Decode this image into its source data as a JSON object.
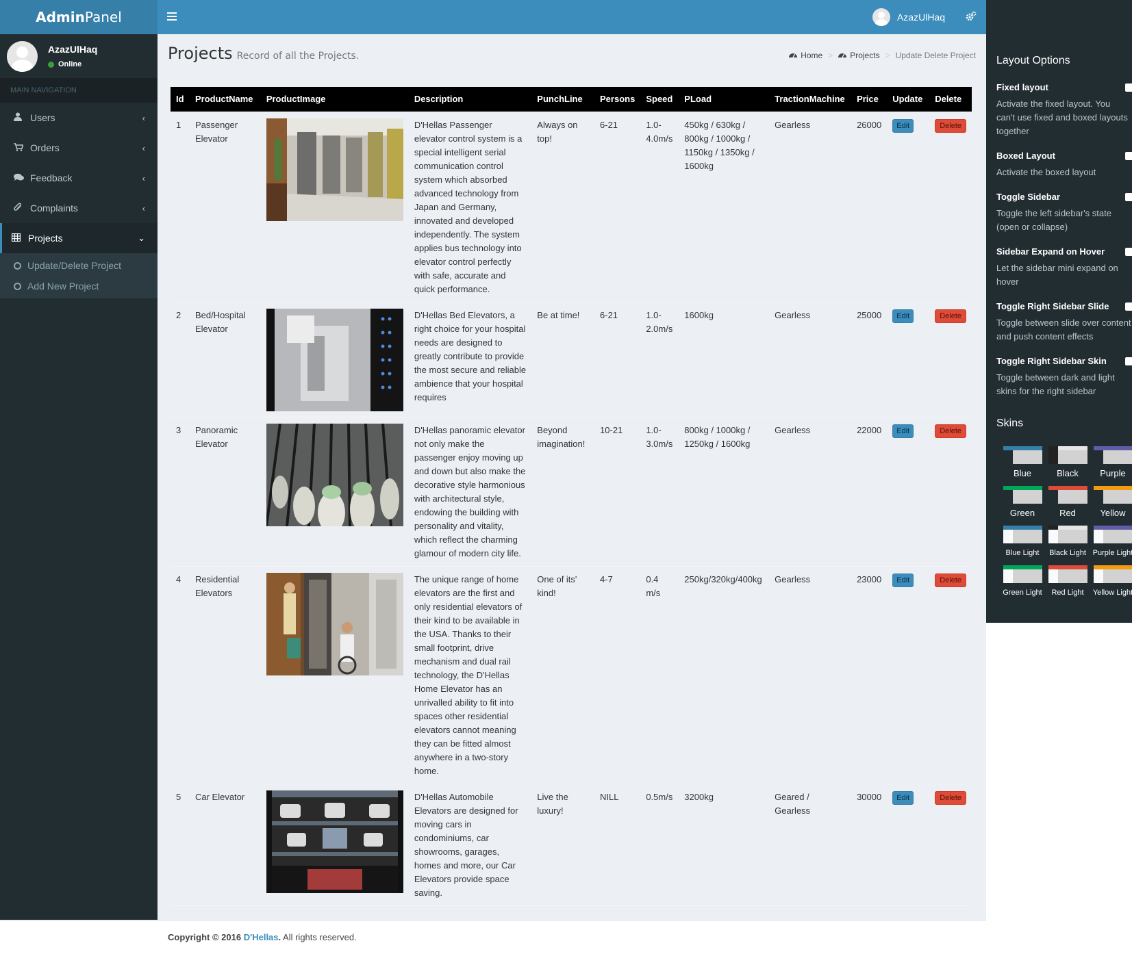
{
  "header": {
    "logo_bold": "Admin",
    "logo_light": "Panel",
    "user_name": "AzazUlHaq"
  },
  "sidebar": {
    "user_name": "AzazUlHaq",
    "status": "Online",
    "nav_header": "MAIN NAVIGATION",
    "items": [
      {
        "label": "Users"
      },
      {
        "label": "Orders"
      },
      {
        "label": "Feedback"
      },
      {
        "label": "Complaints"
      },
      {
        "label": "Projects"
      }
    ],
    "submenu": [
      {
        "label": "Update/Delete Project"
      },
      {
        "label": "Add New Project"
      }
    ]
  },
  "page": {
    "title": "Projects",
    "subtitle": "Record of all the Projects.",
    "breadcrumb": [
      "Home",
      "Projects",
      "Update Delete Project"
    ]
  },
  "table": {
    "headers": [
      "Id",
      "ProductName",
      "ProductImage",
      "Description",
      "PunchLine",
      "Persons",
      "Speed",
      "PLoad",
      "TractionMachine",
      "Price",
      "Update",
      "Delete"
    ],
    "edit_label": "Edit",
    "delete_label": "Delete",
    "rows": [
      {
        "id": "1",
        "name": "Passenger Elevator",
        "description": "D'Hellas Passenger elevator control system is a special intelligent serial communication control system which absorbed advanced technology from Japan and Germany, innovated and developed independently. The system applies bus technology into elevator control perfectly with safe, accurate and quick performance.",
        "punchline": "Always on top!",
        "persons": "6-21",
        "speed": "1.0-4.0m/s",
        "pload": "450kg / 630kg / 800kg / 1000kg / 1150kg / 1350kg / 1600kg",
        "traction": "Gearless",
        "price": "26000"
      },
      {
        "id": "2",
        "name": "Bed/Hospital Elevator",
        "description": "D'Hellas Bed Elevators, a right choice for your hospital needs are designed to greatly contribute to provide the most secure and reliable ambience that your hospital requires",
        "punchline": "Be at time!",
        "persons": "6-21",
        "speed": "1.0-2.0m/s",
        "pload": "1600kg",
        "traction": "Gearless",
        "price": "25000"
      },
      {
        "id": "3",
        "name": "Panoramic Elevator",
        "description": "D'Hellas panoramic elevator not only make the passenger enjoy moving up and down but also make the decorative style harmonious with architectural style, endowing the building with personality and vitality, which reflect the charming glamour of modern city life.",
        "punchline": "Beyond imagination!",
        "persons": "10-21",
        "speed": "1.0-3.0m/s",
        "pload": "800kg / 1000kg / 1250kg / 1600kg",
        "traction": "Gearless",
        "price": "22000"
      },
      {
        "id": "4",
        "name": "Residential Elevators",
        "description": "The unique range of home elevators are the first and only residential elevators of their kind to be available in the USA. Thanks to their small footprint, drive mechanism and dual rail technology, the D'Hellas Home Elevator has an unrivalled ability to fit into spaces other residential elevators cannot meaning they can be fitted almost anywhere in a two-story home.",
        "punchline": "One of its' kind!",
        "persons": "4-7",
        "speed": "0.4 m/s",
        "pload": "250kg/320kg/400kg",
        "traction": "Gearless",
        "price": "23000"
      },
      {
        "id": "5",
        "name": "Car Elevator",
        "description": "D'Hellas Automobile Elevators are designed for moving cars in condominiums, car showrooms, garages, homes and more, our Car Elevators provide space saving.",
        "punchline": "Live the luxury!",
        "persons": "NILL",
        "speed": "0.5m/s",
        "pload": "3200kg",
        "traction": "Geared / Gearless",
        "price": "30000"
      }
    ]
  },
  "footer": {
    "prefix": "Copyright © 2016",
    "company": "D'Hellas",
    "suffix": "All rights reserved."
  },
  "control_sidebar": {
    "title": "Layout Options",
    "options": [
      {
        "title": "Fixed layout",
        "desc": [
          "Activate the fixed layout. You",
          "can't use fixed and boxed layouts",
          "together"
        ]
      },
      {
        "title": "Boxed Layout",
        "desc": [
          "Activate the boxed layout"
        ]
      },
      {
        "title": "Toggle Sidebar",
        "desc": [
          "Toggle the left sidebar's state",
          "(open or collapse)"
        ]
      },
      {
        "title": "Sidebar Expand on Hover",
        "desc": [
          "Let the sidebar mini expand on",
          "hover"
        ]
      },
      {
        "title": "Toggle Right Sidebar Slide",
        "desc": [
          "Toggle between slide over content",
          "and push content effects"
        ]
      },
      {
        "title": "Toggle Right Sidebar Skin",
        "desc": [
          "Toggle between dark and light",
          "skins for the right sidebar"
        ]
      }
    ],
    "skins_title": "Skins",
    "skins": [
      {
        "label": "Blue",
        "top": "#367fa9",
        "side": "#222d32"
      },
      {
        "label": "Black",
        "top": "#ffffff",
        "side": "#222222"
      },
      {
        "label": "Purple",
        "top": "#605ca8",
        "side": "#222d32"
      },
      {
        "label": "Green",
        "top": "#00a65a",
        "side": "#222d32"
      },
      {
        "label": "Red",
        "top": "#dd4b39",
        "side": "#222d32"
      },
      {
        "label": "Yellow",
        "top": "#f39c12",
        "side": "#222d32"
      },
      {
        "label": "Blue Light",
        "top": "#367fa9",
        "side": "#f9fafc"
      },
      {
        "label": "Black Light",
        "top": "#ffffff",
        "side": "#f9fafc"
      },
      {
        "label": "Purple Light",
        "top": "#605ca8",
        "side": "#f9fafc"
      },
      {
        "label": "Green Light",
        "top": "#00a65a",
        "side": "#f9fafc"
      },
      {
        "label": "Red Light",
        "top": "#dd4b39",
        "side": "#f9fafc"
      },
      {
        "label": "Yellow Light",
        "top": "#f39c12",
        "side": "#f9fafc"
      }
    ]
  },
  "icons": {
    "menu": "hamburger-icon",
    "settings": "gears-icon",
    "users": "user-icon",
    "orders": "cart-icon",
    "feedback": "comments-icon",
    "complaints": "paperclip-icon",
    "projects": "table-icon",
    "breadcrumb": "dashboard-icon"
  }
}
